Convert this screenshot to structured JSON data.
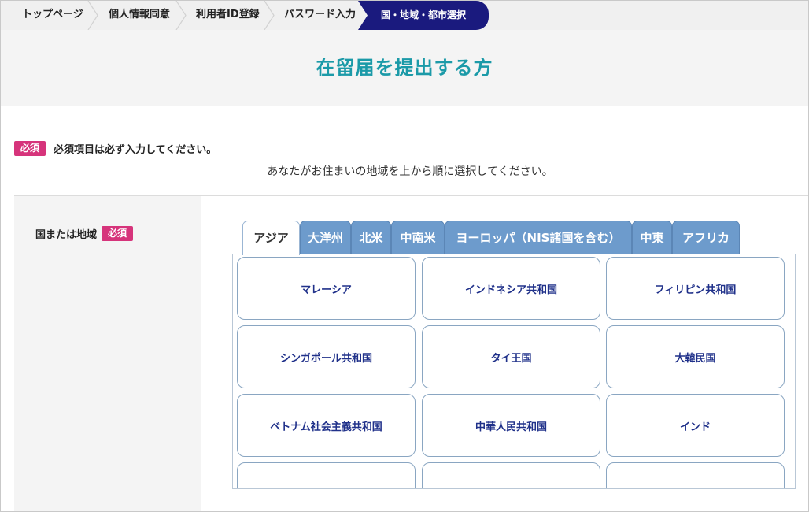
{
  "breadcrumb": {
    "items": [
      {
        "label": "トップページ"
      },
      {
        "label": "個人情報同意"
      },
      {
        "label": "利用者ID登録"
      },
      {
        "label": "パスワード入力"
      }
    ],
    "active": "国・地域・都市選択"
  },
  "page": {
    "title": "在留届を提出する方",
    "required_badge": "必須",
    "required_note": "必須項目は必ず入力してください。",
    "instruction": "あなたがお住まいの地域を上から順に選択してください。"
  },
  "form": {
    "field_label": "国または地域",
    "field_badge": "必須"
  },
  "tabs": [
    {
      "label": "アジア",
      "active": true
    },
    {
      "label": "大洋州"
    },
    {
      "label": "北米"
    },
    {
      "label": "中南米"
    },
    {
      "label": "ヨーロッパ（NIS諸国を含む）"
    },
    {
      "label": "中東"
    },
    {
      "label": "アフリカ"
    }
  ],
  "countries": [
    "マレーシア",
    "インドネシア共和国",
    "フィリピン共和国",
    "シンガポール共和国",
    "タイ王国",
    "大韓民国",
    "ベトナム社会主義共和国",
    "中華人民共和国",
    "インド",
    "",
    "",
    ""
  ],
  "colors": {
    "title": "#1b9aa8",
    "badge": "#d6347b",
    "tab": "#6d9bcc",
    "breadcrumb_active": "#1a1a7e",
    "country_text": "#20318a"
  }
}
